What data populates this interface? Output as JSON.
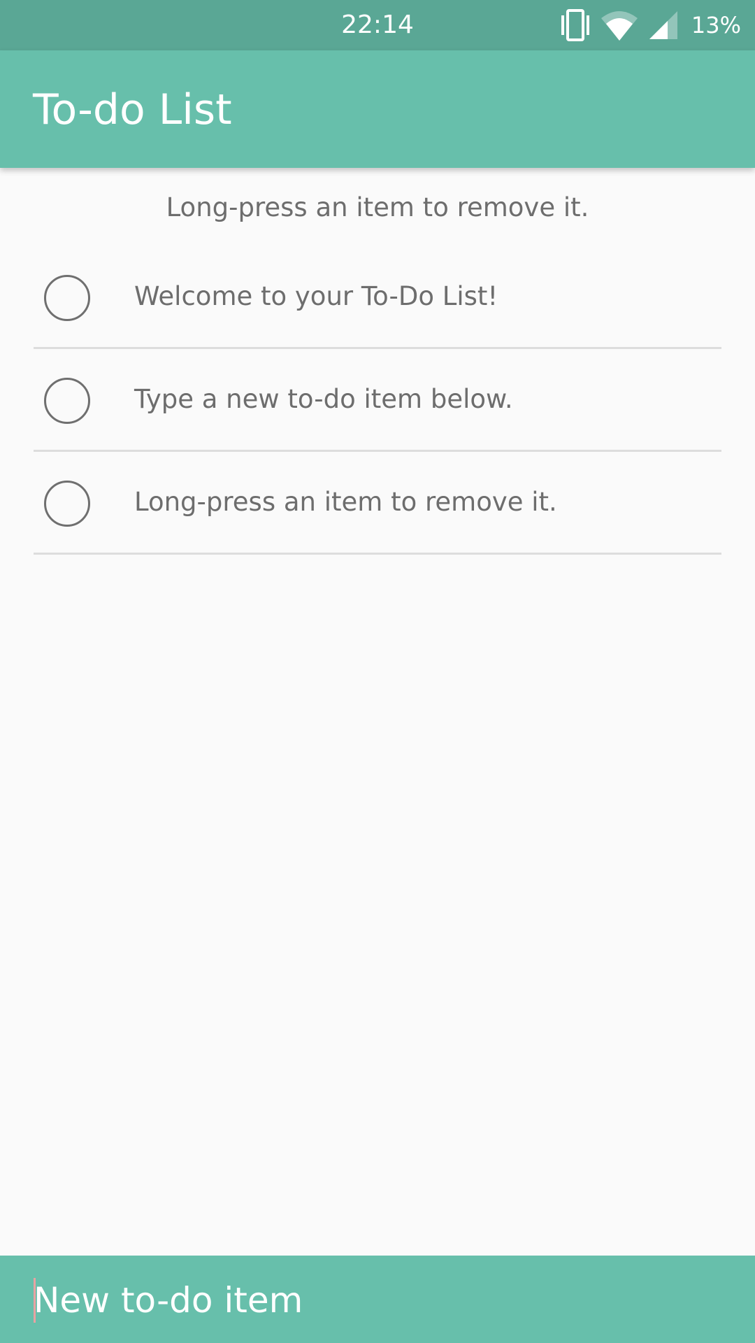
{
  "status_bar": {
    "time": "22:14",
    "battery": "13%",
    "icons": [
      "vibrate-icon",
      "wifi-icon",
      "cellular-signal-icon"
    ]
  },
  "app_bar": {
    "title": "To-do List"
  },
  "hint": "Long-press an item to remove it.",
  "todos": [
    {
      "text": "Welcome to your To-Do List!",
      "checked": false
    },
    {
      "text": "Type a new to-do item below.",
      "checked": false
    },
    {
      "text": "Long-press an item to remove it.",
      "checked": false
    }
  ],
  "input": {
    "placeholder": "New to-do item",
    "value": ""
  },
  "colors": {
    "status_bar": "#5aa795",
    "primary": "#67bfab",
    "background": "#fafafa",
    "text": "#6d6d6d",
    "divider": "#dddddd",
    "caret": "#e8a3a3"
  }
}
